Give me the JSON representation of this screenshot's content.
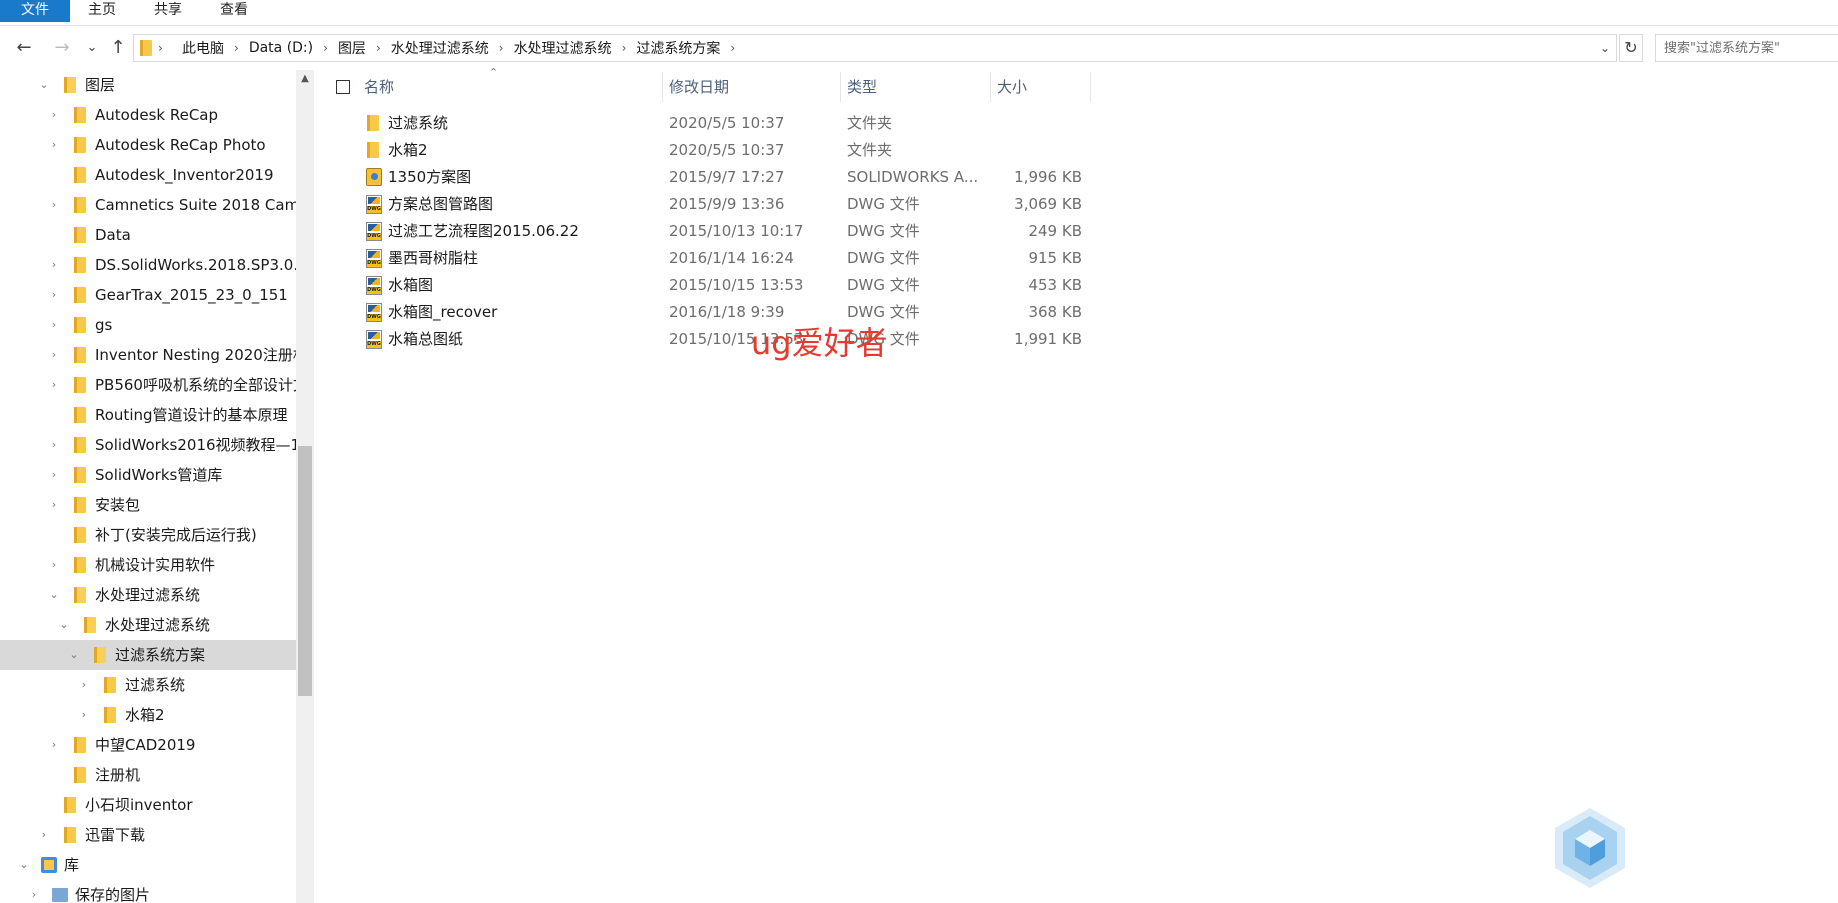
{
  "ribbon": {
    "tabs": [
      {
        "label": "文件",
        "active": true
      },
      {
        "label": "主页"
      },
      {
        "label": "共享"
      },
      {
        "label": "查看"
      }
    ]
  },
  "nav": {
    "back_icon": "←",
    "forward_icon": "→",
    "recent_icon": "⌄",
    "up_icon": "↑"
  },
  "address": {
    "crumbs": [
      "此电脑",
      "Data (D:)",
      "图层",
      "水处理过滤系统",
      "水处理过滤系统",
      "过滤系统方案"
    ],
    "separator": "›",
    "dropdown_icon": "⌄",
    "refresh_icon": "↻"
  },
  "search": {
    "placeholder": "搜索\"过滤系统方案\""
  },
  "sidebar": {
    "items": [
      {
        "label": "图层",
        "chevron": "⌄"
      },
      {
        "label": "Autodesk ReCap",
        "chevron": "›"
      },
      {
        "label": "Autodesk ReCap Photo",
        "chevron": "›"
      },
      {
        "label": "Autodesk_Inventor2019",
        "chevron": ""
      },
      {
        "label": "Camnetics Suite 2018 CamT",
        "chevron": "›"
      },
      {
        "label": "Data",
        "chevron": ""
      },
      {
        "label": "DS.SolidWorks.2018.SP3.0.F",
        "chevron": "›"
      },
      {
        "label": "GearTrax_2015_23_0_151",
        "chevron": "›"
      },
      {
        "label": "gs",
        "chevron": "›"
      },
      {
        "label": "Inventor Nesting 2020注册机",
        "chevron": "›"
      },
      {
        "label": "PB560呼吸机系统的全部设计文",
        "chevron": "›"
      },
      {
        "label": "Routing管道设计的基本原理",
        "chevron": ""
      },
      {
        "label": "SolidWorks2016视频教程—1",
        "chevron": "›"
      },
      {
        "label": "SolidWorks管道库",
        "chevron": "›"
      },
      {
        "label": "安装包",
        "chevron": "›"
      },
      {
        "label": "补丁(安装完成后运行我)",
        "chevron": ""
      },
      {
        "label": "机械设计实用软件",
        "chevron": "›"
      },
      {
        "label": "水处理过滤系统",
        "chevron": "⌄"
      },
      {
        "label": "水处理过滤系统",
        "chevron": "⌄"
      },
      {
        "label": "过滤系统方案",
        "chevron": "⌄"
      },
      {
        "label": "过滤系统",
        "chevron": "›"
      },
      {
        "label": "水箱2",
        "chevron": "›"
      },
      {
        "label": "中望CAD2019",
        "chevron": "›"
      },
      {
        "label": "注册机",
        "chevron": ""
      },
      {
        "label": "小石坝inventor",
        "chevron": ""
      },
      {
        "label": "迅雷下载",
        "chevron": "›"
      },
      {
        "label": "库",
        "chevron": "⌄"
      },
      {
        "label": "保存的图片",
        "chevron": "›"
      }
    ],
    "scroll_up_icon": "▲"
  },
  "columns": {
    "name": "名称",
    "date": "修改日期",
    "type": "类型",
    "size": "大小",
    "sort_icon": "⌃"
  },
  "files": [
    {
      "name": "过滤系统",
      "date": "2020/5/5 10:37",
      "type": "文件夹",
      "size": "",
      "icon": "folder-icon"
    },
    {
      "name": "水箱2",
      "date": "2020/5/5 10:37",
      "type": "文件夹",
      "size": "",
      "icon": "folder-icon"
    },
    {
      "name": "1350方案图",
      "date": "2015/9/7 17:27",
      "type": "SOLIDWORKS A...",
      "size": "1,996 KB",
      "icon": "solidworks-file-icon"
    },
    {
      "name": "方案总图管路图",
      "date": "2015/9/9 13:36",
      "type": "DWG 文件",
      "size": "3,069 KB",
      "icon": "dwg-file-icon"
    },
    {
      "name": "过滤工艺流程图2015.06.22",
      "date": "2015/10/13 10:17",
      "type": "DWG 文件",
      "size": "249 KB",
      "icon": "dwg-file-icon"
    },
    {
      "name": "墨西哥树脂柱",
      "date": "2016/1/14 16:24",
      "type": "DWG 文件",
      "size": "915 KB",
      "icon": "dwg-file-icon"
    },
    {
      "name": "水箱图",
      "date": "2015/10/15 13:53",
      "type": "DWG 文件",
      "size": "453 KB",
      "icon": "dwg-file-icon"
    },
    {
      "name": "水箱图_recover",
      "date": "2016/1/18 9:39",
      "type": "DWG 文件",
      "size": "368 KB",
      "icon": "dwg-file-icon"
    },
    {
      "name": "水箱总图纸",
      "date": "2015/10/15 13:53",
      "type": "DWG 文件",
      "size": "1,991 KB",
      "icon": "dwg-file-icon"
    }
  ],
  "overlay": {
    "watermark": "ug爱好者"
  },
  "colors": {
    "accent": "#1979ca",
    "selection": "#d9d9d9",
    "header_text": "#4c607a",
    "watermark": "#e53a2f"
  }
}
